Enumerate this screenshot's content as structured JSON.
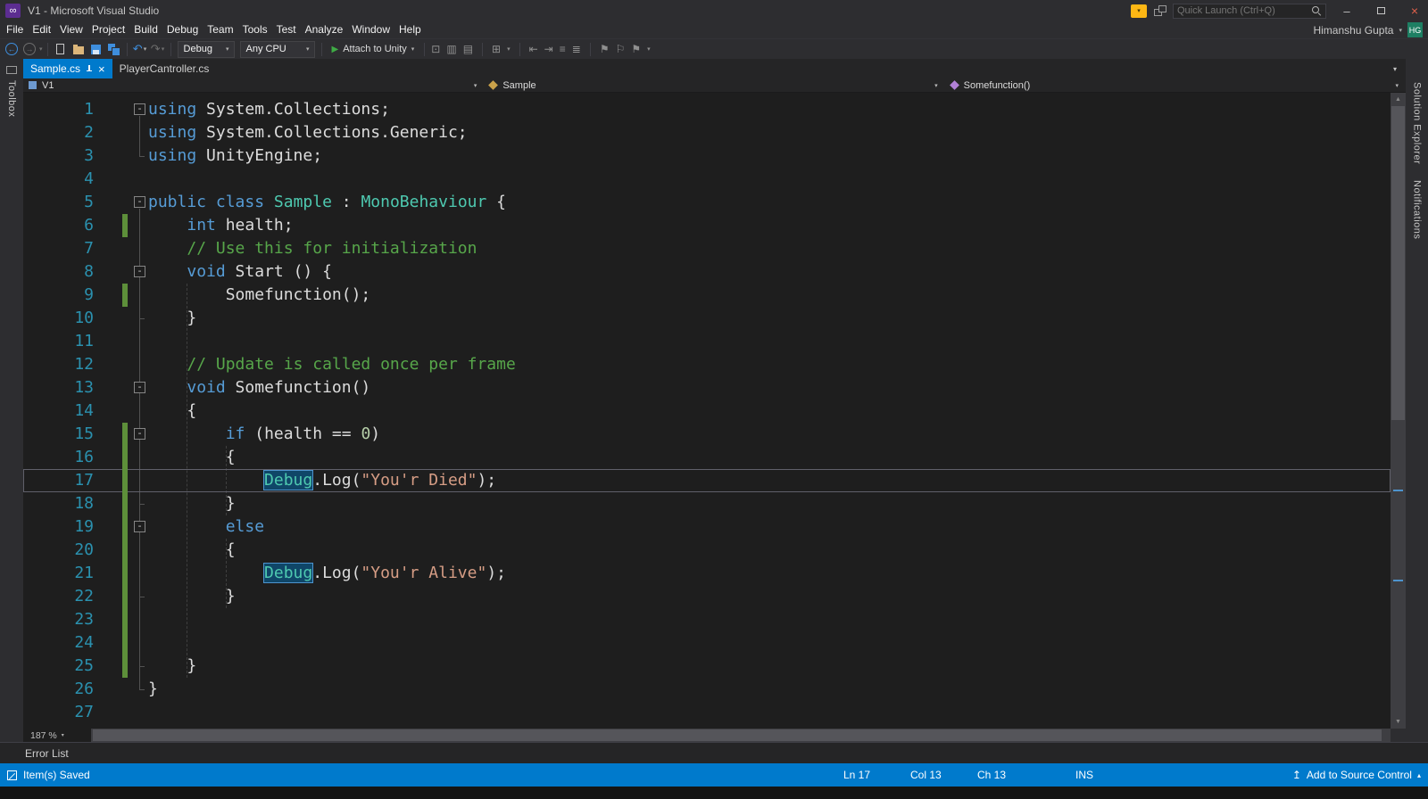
{
  "window": {
    "logo": "∞",
    "title": "V1 - Microsoft Visual Studio",
    "quick_launch_placeholder": "Quick Launch (Ctrl+Q)",
    "controls": {
      "minimize": "–",
      "close": "×"
    }
  },
  "icons": {
    "close": "×",
    "caret_down": "▾",
    "caret_up": "▴",
    "scroll_up": "▲",
    "scroll_down": "▼",
    "publish": "↥",
    "back": "←",
    "forward": "→",
    "undo": "↶",
    "redo": "↷",
    "play": "▶"
  },
  "menu": {
    "items": [
      "File",
      "Edit",
      "View",
      "Project",
      "Build",
      "Debug",
      "Team",
      "Tools",
      "Test",
      "Analyze",
      "Window",
      "Help"
    ]
  },
  "user": {
    "name": "Himanshu Gupta",
    "initials": "HG"
  },
  "toolbar": {
    "debug_config": "Debug",
    "platform": "Any CPU",
    "attach_label": "Attach to Unity",
    "tail_icons": [
      {
        "name": "attach-process-icon",
        "glyph": "⊡"
      },
      {
        "name": "diagnostics-icon",
        "glyph": "▥"
      },
      {
        "name": "performance-icon",
        "glyph": "▤"
      },
      {
        "name": "separator"
      },
      {
        "name": "grid-options-icon",
        "glyph": "⊞"
      },
      {
        "name": "dropdown-caret-icon",
        "glyph": "▾",
        "small": true
      },
      {
        "name": "separator"
      },
      {
        "name": "navigate-backward-icon",
        "glyph": "⇤"
      },
      {
        "name": "navigate-forward-icon",
        "glyph": "⇥"
      },
      {
        "name": "line-comment-icon",
        "glyph": "≡"
      },
      {
        "name": "block-comment-icon",
        "glyph": "≣"
      },
      {
        "name": "separator"
      },
      {
        "name": "bookmark-icon",
        "glyph": "⚑"
      },
      {
        "name": "previous-bookmark-icon",
        "glyph": "⚐"
      },
      {
        "name": "next-bookmark-icon",
        "glyph": "⚑"
      },
      {
        "name": "dropdown-caret-icon",
        "glyph": "▾",
        "small": true
      }
    ]
  },
  "tabs": [
    {
      "label": "Sample.cs",
      "active": true
    },
    {
      "label": "PlayerCantroller.cs",
      "active": false
    }
  ],
  "breadcrumbs": [
    {
      "label": "V1",
      "icon": "project-icon"
    },
    {
      "label": "Sample",
      "icon": "class-icon"
    },
    {
      "label": "Somefunction()",
      "icon": "method-icon"
    }
  ],
  "left_panel": {
    "label": "Toolbox"
  },
  "right_panels": [
    "Solution Explorer",
    "Notifications"
  ],
  "editor": {
    "zoom": "187 %",
    "lines": [
      {
        "n": 1,
        "fold": true,
        "tokens": [
          [
            "kw",
            "using"
          ],
          [
            "pl",
            " System.Collections;"
          ]
        ]
      },
      {
        "n": 2,
        "tokens": [
          [
            "kw",
            "using"
          ],
          [
            "pl",
            " System.Collections.Generic;"
          ]
        ]
      },
      {
        "n": 3,
        "tokens": [
          [
            "kw",
            "using"
          ],
          [
            "pl",
            " UnityEngine;"
          ]
        ]
      },
      {
        "n": 4,
        "tokens": []
      },
      {
        "n": 5,
        "fold": true,
        "tokens": [
          [
            "kw",
            "public"
          ],
          [
            "pl",
            " "
          ],
          [
            "kw",
            "class"
          ],
          [
            "pl",
            " "
          ],
          [
            "ty",
            "Sample"
          ],
          [
            "pl",
            " : "
          ],
          [
            "ty",
            "MonoBehaviour"
          ],
          [
            "pl",
            " {"
          ]
        ]
      },
      {
        "n": 6,
        "change": true,
        "tokens": [
          [
            "pl",
            "    "
          ],
          [
            "kw",
            "int"
          ],
          [
            "pl",
            " health;"
          ]
        ]
      },
      {
        "n": 7,
        "tokens": [
          [
            "pl",
            "    "
          ],
          [
            "cm",
            "// Use this for initialization"
          ]
        ]
      },
      {
        "n": 8,
        "fold": true,
        "tokens": [
          [
            "pl",
            "    "
          ],
          [
            "kw",
            "void"
          ],
          [
            "pl",
            " Start () {"
          ]
        ]
      },
      {
        "n": 9,
        "change": true,
        "tokens": [
          [
            "pl",
            "        Somefunction();"
          ]
        ]
      },
      {
        "n": 10,
        "tokens": [
          [
            "pl",
            "    }"
          ]
        ]
      },
      {
        "n": 11,
        "tokens": []
      },
      {
        "n": 12,
        "tokens": [
          [
            "pl",
            "    "
          ],
          [
            "cm",
            "// Update is called once per frame"
          ]
        ]
      },
      {
        "n": 13,
        "fold": true,
        "tokens": [
          [
            "pl",
            "    "
          ],
          [
            "kw",
            "void"
          ],
          [
            "pl",
            " Somefunction()"
          ]
        ]
      },
      {
        "n": 14,
        "tokens": [
          [
            "pl",
            "    {"
          ]
        ]
      },
      {
        "n": 15,
        "fold": true,
        "change": true,
        "tokens": [
          [
            "pl",
            "        "
          ],
          [
            "kw",
            "if"
          ],
          [
            "pl",
            " (health == "
          ],
          [
            "nu",
            "0"
          ],
          [
            "pl",
            ")"
          ]
        ]
      },
      {
        "n": 16,
        "change": true,
        "tokens": [
          [
            "pl",
            "        {"
          ]
        ]
      },
      {
        "n": 17,
        "change": true,
        "current": true,
        "tokens": [
          [
            "pl",
            "            "
          ],
          [
            "hl",
            "Debug"
          ],
          [
            "pl",
            ".Log("
          ],
          [
            "st",
            "\"You'r Died\""
          ],
          [
            "pl",
            ");"
          ]
        ]
      },
      {
        "n": 18,
        "change": true,
        "tokens": [
          [
            "pl",
            "        }"
          ]
        ]
      },
      {
        "n": 19,
        "fold": true,
        "change": true,
        "tokens": [
          [
            "pl",
            "        "
          ],
          [
            "kw",
            "else"
          ]
        ]
      },
      {
        "n": 20,
        "change": true,
        "tokens": [
          [
            "pl",
            "        {"
          ]
        ]
      },
      {
        "n": 21,
        "change": true,
        "tokens": [
          [
            "pl",
            "            "
          ],
          [
            "hl",
            "Debug"
          ],
          [
            "pl",
            ".Log("
          ],
          [
            "st",
            "\"You'r Alive\""
          ],
          [
            "pl",
            ");"
          ]
        ]
      },
      {
        "n": 22,
        "change": true,
        "tokens": [
          [
            "pl",
            "        }"
          ]
        ]
      },
      {
        "n": 23,
        "change": true,
        "tokens": []
      },
      {
        "n": 24,
        "change": true,
        "tokens": []
      },
      {
        "n": 25,
        "change": true,
        "tokens": [
          [
            "pl",
            "    }"
          ]
        ]
      },
      {
        "n": 26,
        "tokens": [
          [
            "pl",
            "}"
          ]
        ]
      },
      {
        "n": 27,
        "tokens": []
      }
    ]
  },
  "error_list": {
    "label": "Error List"
  },
  "status_bar": {
    "message": "Item(s) Saved",
    "line": "Ln 17",
    "column": "Col 13",
    "character": "Ch 13",
    "mode": "INS",
    "source_control": "Add to Source Control"
  },
  "colors": {
    "accent": "#007acc",
    "keyword": "#569cd6",
    "type": "#4ec9b0",
    "comment": "#57a64a",
    "string": "#d69d85",
    "number": "#b5cea8",
    "line_number": "#2b91af",
    "change_bar": "#5d8f3a"
  }
}
